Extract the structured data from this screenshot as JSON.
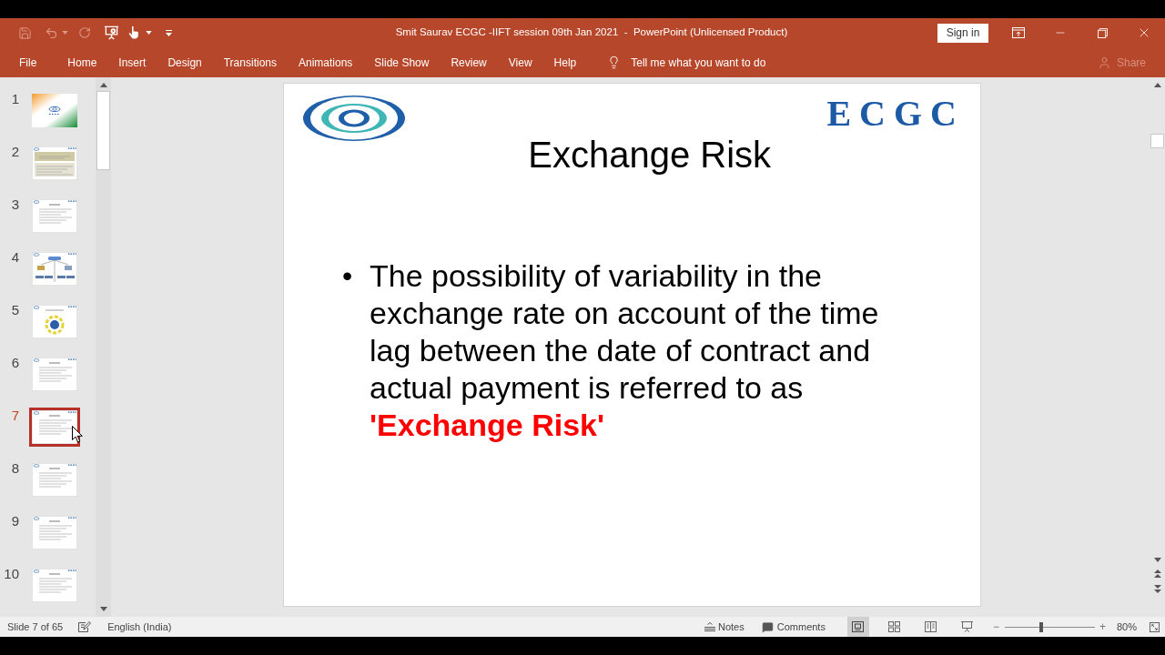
{
  "window": {
    "title": "Smit Saurav ECGC -IIFT session 09th Jan 2021  -  PowerPoint (Unlicensed Product)",
    "sign_in": "Sign in"
  },
  "quick_access": [
    {
      "kind": "save",
      "disabled": true
    },
    {
      "kind": "undo",
      "disabled": true
    },
    {
      "kind": "redo",
      "disabled": true
    },
    {
      "kind": "present",
      "disabled": false
    },
    {
      "kind": "touch",
      "disabled": false
    },
    {
      "kind": "customize",
      "disabled": false
    }
  ],
  "ribbon": {
    "tabs": [
      {
        "label": "File",
        "selected": false
      },
      {
        "label": "Home",
        "selected": false
      },
      {
        "label": "Insert",
        "selected": false
      },
      {
        "label": "Design",
        "selected": false
      },
      {
        "label": "Transitions",
        "selected": false
      },
      {
        "label": "Animations",
        "selected": false
      },
      {
        "label": "Slide Show",
        "selected": false
      },
      {
        "label": "Review",
        "selected": false
      },
      {
        "label": "View",
        "selected": false
      },
      {
        "label": "Help",
        "selected": false
      }
    ],
    "tell_me": "Tell me what you want to do",
    "share": {
      "label": "Share",
      "disabled": true
    }
  },
  "thumbnails": [
    {
      "number": "1",
      "kind": "cover",
      "selected": false
    },
    {
      "number": "2",
      "kind": "panels",
      "selected": false
    },
    {
      "number": "3",
      "kind": "list",
      "selected": false
    },
    {
      "number": "4",
      "kind": "diagram",
      "selected": false
    },
    {
      "number": "5",
      "kind": "cycle",
      "selected": false
    },
    {
      "number": "6",
      "kind": "list",
      "selected": false
    },
    {
      "number": "7",
      "kind": "list",
      "selected": true
    },
    {
      "number": "8",
      "kind": "list",
      "selected": false
    },
    {
      "number": "9",
      "kind": "list",
      "selected": false
    },
    {
      "number": "10",
      "kind": "list",
      "selected": false
    }
  ],
  "slide": {
    "logo_text": "ECGC",
    "title": "Exchange Risk",
    "bullets": [
      {
        "marker": "•",
        "text": "The possibility of variability in the exchange rate on account of the time lag between the date of contract and actual payment is referred to as",
        "highlight": "'Exchange Risk'"
      }
    ]
  },
  "status_bar": {
    "slide_info": "Slide 7 of 65",
    "language": "English (India)",
    "notes": "Notes",
    "comments": "Comments",
    "views": [
      {
        "kind": "normal",
        "selected": true
      },
      {
        "kind": "sorter",
        "selected": false
      },
      {
        "kind": "reading",
        "selected": false
      },
      {
        "kind": "slideshow",
        "selected": false
      }
    ],
    "zoom": {
      "minus": "−",
      "plus": "+",
      "level": 0.4,
      "reading": "80%"
    }
  }
}
